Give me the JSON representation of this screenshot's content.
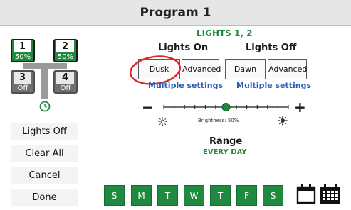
{
  "header": {
    "title": "Program 1"
  },
  "zones": [
    {
      "number": "1",
      "status": "50%",
      "state": "on"
    },
    {
      "number": "2",
      "status": "50%",
      "state": "on"
    },
    {
      "number": "3",
      "status": "Off",
      "state": "off"
    },
    {
      "number": "4",
      "status": "Off",
      "state": "off"
    }
  ],
  "sidebar": {
    "lights_off": "Lights Off",
    "clear_all": "Clear All",
    "cancel": "Cancel",
    "done": "Done"
  },
  "lights": {
    "heading": "LIGHTS 1, 2",
    "on_heading": "Lights On",
    "off_heading": "Lights Off",
    "on_dusk": "Dusk",
    "on_advanced": "Advanced",
    "off_dawn": "Dawn",
    "off_advanced": "Advanced",
    "on_multiple": "Multiple settings",
    "off_multiple": "Multiple settings"
  },
  "brightness": {
    "minus": "−",
    "plus": "+",
    "label": "Brightness: 50%",
    "level": 0.5
  },
  "range": {
    "title": "Range",
    "value": "EVERY DAY"
  },
  "days": [
    "S",
    "M",
    "T",
    "W",
    "T",
    "F",
    "S"
  ],
  "icons": [
    "clock-icon",
    "sun-dim-icon",
    "sun-bright-icon",
    "calendar-icon",
    "calendar-grid-icon"
  ],
  "colors": {
    "green": "#1f8a3f",
    "blue": "#2a5db8",
    "highlight": "#e0252b"
  }
}
